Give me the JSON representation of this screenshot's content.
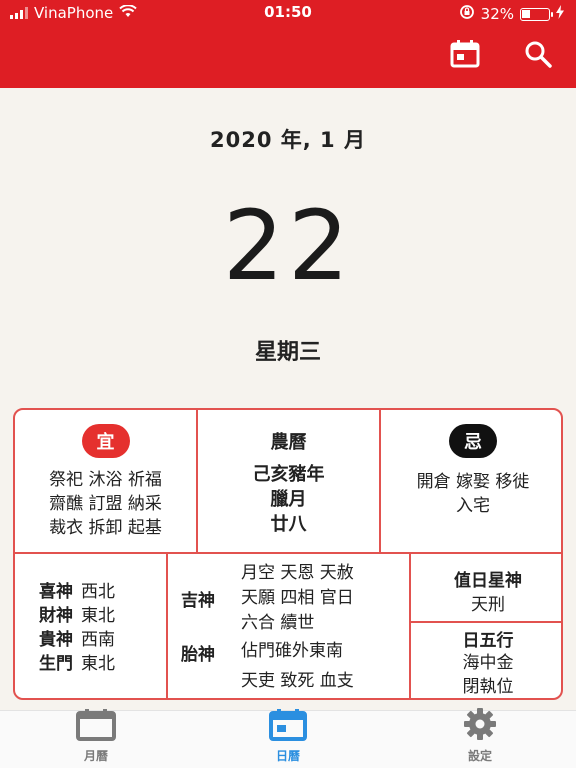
{
  "status_bar": {
    "carrier": "VinaPhone",
    "time": "01:50",
    "battery_percent": "32%",
    "battery_level": 0.32
  },
  "app_bar": {
    "icons": [
      "calendar-icon",
      "search-icon"
    ],
    "accent_color": "#de1e24"
  },
  "date": {
    "year_month": "2020 年, 1 月",
    "day": "22",
    "weekday": "星期三"
  },
  "panel": {
    "yi": {
      "badge": "宜",
      "lines": [
        "祭祀 沐浴 祈福",
        "齋醮 訂盟 納采",
        "裁衣 拆卸 起基"
      ]
    },
    "nongli": {
      "title": "農曆",
      "lines": [
        "己亥豬年",
        "臘月",
        "廿八"
      ]
    },
    "ji": {
      "badge": "忌",
      "lines": [
        "開倉 嫁娶 移徙",
        "入宅"
      ]
    },
    "directions": [
      {
        "label": "喜神",
        "value": "西北"
      },
      {
        "label": "財神",
        "value": "東北"
      },
      {
        "label": "貴神",
        "value": "西南"
      },
      {
        "label": "生門",
        "value": "東北"
      }
    ],
    "jishen": {
      "label": "吉神",
      "lines": [
        "月空 天恩 天赦",
        "天願 四相 官日",
        "六合 續世"
      ]
    },
    "taishen": {
      "label": "胎神",
      "value": "佔門碓外東南"
    },
    "xiongsha": "天吏 致死 血支",
    "zhiri": {
      "title": "值日星神",
      "value": "天刑"
    },
    "wuxing": {
      "title": "日五行",
      "lines": [
        "海中金",
        "閉執位"
      ]
    }
  },
  "tabs": [
    {
      "label": "月曆",
      "icon": "month-calendar-icon",
      "active": false
    },
    {
      "label": "日曆",
      "icon": "day-calendar-icon",
      "active": true
    },
    {
      "label": "設定",
      "icon": "gear-icon",
      "active": false
    }
  ],
  "colors": {
    "active_tab": "#2b8fe0",
    "inactive_tab": "#7a7a7a",
    "panel_border": "#e2524f"
  }
}
